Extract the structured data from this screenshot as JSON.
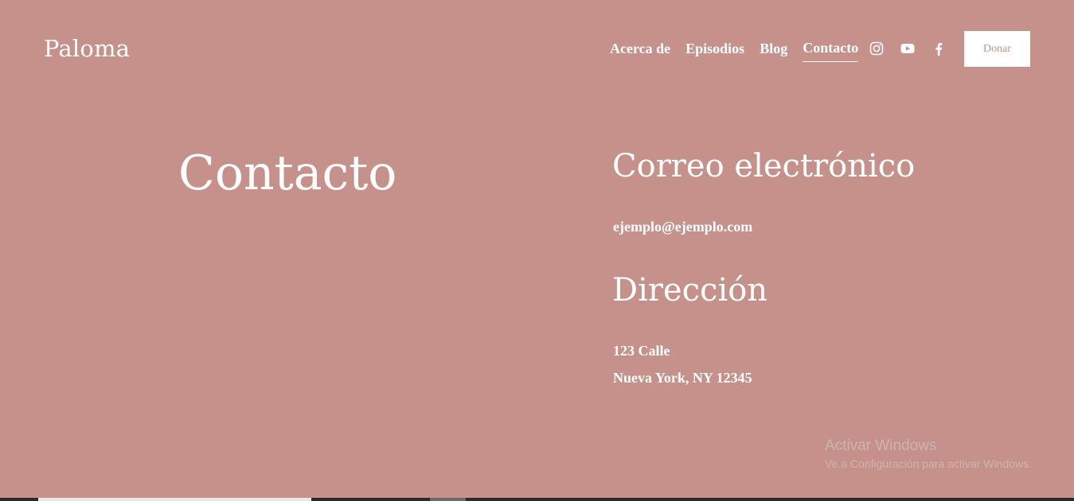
{
  "site": {
    "brand": "Paloma"
  },
  "nav": {
    "links": [
      {
        "label": "Acerca de",
        "active": false
      },
      {
        "label": "Episodios",
        "active": false
      },
      {
        "label": "Blog",
        "active": false
      },
      {
        "label": "Contacto",
        "active": true
      }
    ],
    "social_icons": [
      "instagram-icon",
      "youtube-icon",
      "facebook-icon"
    ],
    "donate_label": "Donar"
  },
  "main": {
    "title": "Contacto",
    "email": {
      "heading": "Correo electrónico",
      "value": "ejemplo@ejemplo.com"
    },
    "address": {
      "heading": "Dirección",
      "line1": "123 Calle",
      "line2": "Nueva York, NY 12345"
    }
  },
  "watermark": {
    "title": "Activar Windows",
    "subtitle": "Ve a Configuración para activar Windows."
  },
  "colors": {
    "background": "#c6918a",
    "text": "#ffffff",
    "button_bg": "#ffffff",
    "button_text": "#c6918a"
  }
}
